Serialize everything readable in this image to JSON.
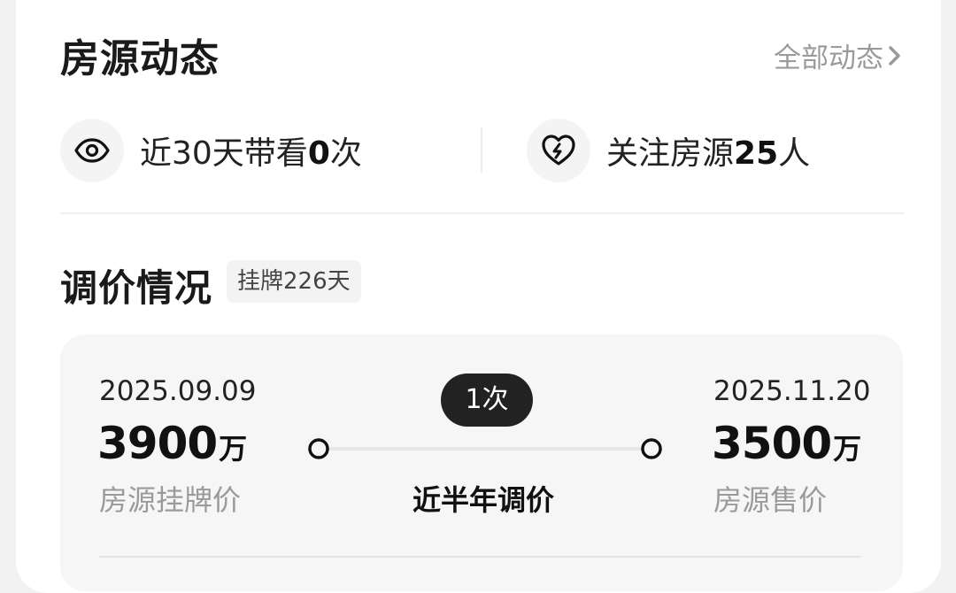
{
  "dynamics": {
    "title": "房源动态",
    "all_link": "全部动态",
    "viewings": {
      "label": "近30天带看",
      "count": "0",
      "unit": "次",
      "icon": "eye-icon"
    },
    "followers": {
      "label": "关注房源",
      "count": "25",
      "unit": "人",
      "icon": "heart-icon"
    }
  },
  "price_changes": {
    "title": "调价情况",
    "listing_days": "挂牌226天",
    "change_count": "1次",
    "period_label": "近半年调价",
    "start": {
      "date": "2025.09.09",
      "price": "3900",
      "unit": "万",
      "label": "房源挂牌价"
    },
    "end": {
      "date": "2025.11.20",
      "price": "3500",
      "unit": "万",
      "label": "房源售价"
    }
  }
}
